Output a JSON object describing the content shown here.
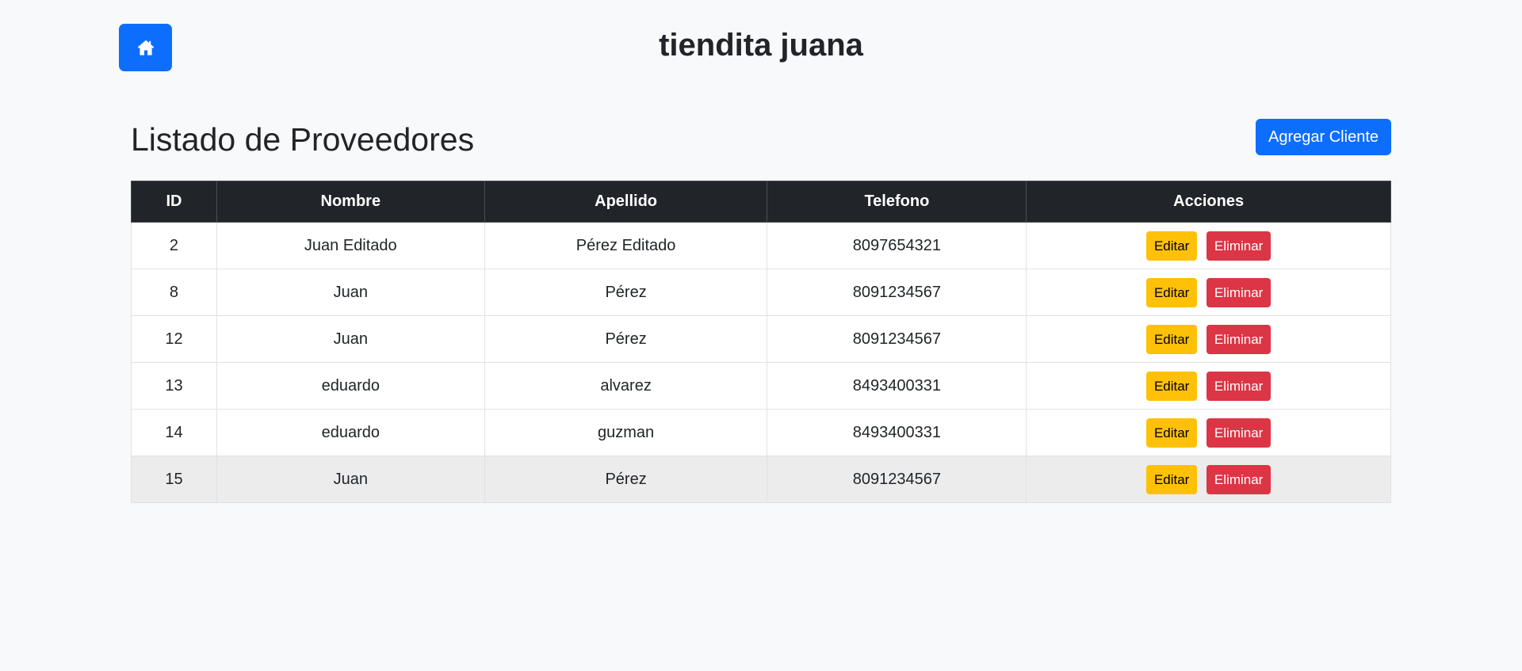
{
  "header": {
    "site_title": "tiendita juana",
    "home_icon": "home-icon"
  },
  "page": {
    "title": "Listado de Proveedores",
    "add_button_label": "Agregar Cliente"
  },
  "table": {
    "columns": [
      "ID",
      "Nombre",
      "Apellido",
      "Telefono",
      "Acciones"
    ],
    "rows": [
      {
        "id": "2",
        "nombre": "Juan Editado",
        "apellido": "Pérez Editado",
        "telefono": "8097654321"
      },
      {
        "id": "8",
        "nombre": "Juan",
        "apellido": "Pérez",
        "telefono": "8091234567"
      },
      {
        "id": "12",
        "nombre": "Juan",
        "apellido": "Pérez",
        "telefono": "8091234567"
      },
      {
        "id": "13",
        "nombre": "eduardo",
        "apellido": "alvarez",
        "telefono": "8493400331"
      },
      {
        "id": "14",
        "nombre": "eduardo",
        "apellido": "guzman",
        "telefono": "8493400331"
      },
      {
        "id": "15",
        "nombre": "Juan",
        "apellido": "Pérez",
        "telefono": "8091234567"
      }
    ],
    "edit_label": "Editar",
    "delete_label": "Eliminar"
  },
  "colors": {
    "primary": "#0d6efd",
    "warning": "#ffc107",
    "danger": "#dc3545",
    "table_header": "#212529",
    "page_background": "#f8f9fa"
  }
}
